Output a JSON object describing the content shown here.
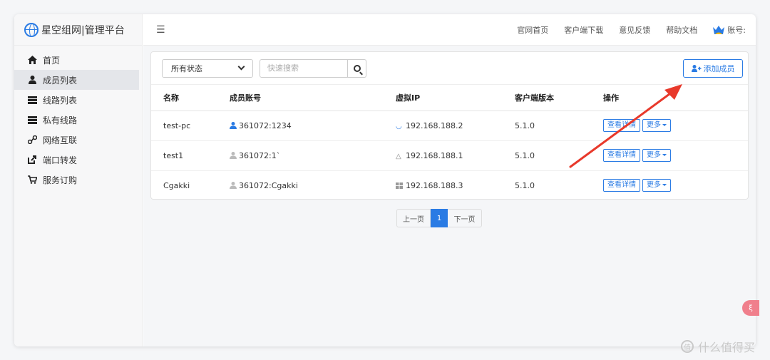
{
  "app": {
    "title": "星空组网|管理平台"
  },
  "sidebar": {
    "items": [
      {
        "label": "首页",
        "icon": "home-icon"
      },
      {
        "label": "成员列表",
        "icon": "user-icon",
        "active": true
      },
      {
        "label": "线路列表",
        "icon": "server-icon"
      },
      {
        "label": "私有线路",
        "icon": "server-icon"
      },
      {
        "label": "网络互联",
        "icon": "network-icon"
      },
      {
        "label": "端口转发",
        "icon": "external-link-icon"
      },
      {
        "label": "服务订购",
        "icon": "cart-icon"
      }
    ]
  },
  "topbar": {
    "menu_icon": "hamburger-icon",
    "links": [
      "官网首页",
      "客户端下载",
      "意见反馈",
      "帮助文档"
    ],
    "account_label": "账号:"
  },
  "filters": {
    "status_value": "所有状态",
    "search_placeholder": "快速搜索",
    "add_button": "添加成员"
  },
  "table": {
    "headers": [
      "名称",
      "成员账号",
      "虚拟IP",
      "客户端版本",
      "操作"
    ],
    "rows": [
      {
        "name": "test-pc",
        "account": "361072:1234",
        "ip": "192.168.188.2",
        "version": "5.1.0",
        "online": true,
        "ip_icon": "edge-icon"
      },
      {
        "name": "test1",
        "account": "361072:1`",
        "ip": "192.168.188.1",
        "version": "5.1.0",
        "online": false,
        "ip_icon": "linux-icon"
      },
      {
        "name": "Cgakki",
        "account": "361072:Cgakki",
        "ip": "192.168.188.3",
        "version": "5.1.0",
        "online": false,
        "ip_icon": "windows-icon"
      }
    ],
    "detail_button": "查看详情",
    "more_button": "更多"
  },
  "pagination": {
    "prev": "上一页",
    "current": "1",
    "next": "下一页"
  },
  "float_badge": "ξ",
  "watermark": {
    "icon": "值",
    "text": "什么值得买"
  },
  "colors": {
    "accent": "#2a7be4",
    "arrow": "#e8392b"
  }
}
